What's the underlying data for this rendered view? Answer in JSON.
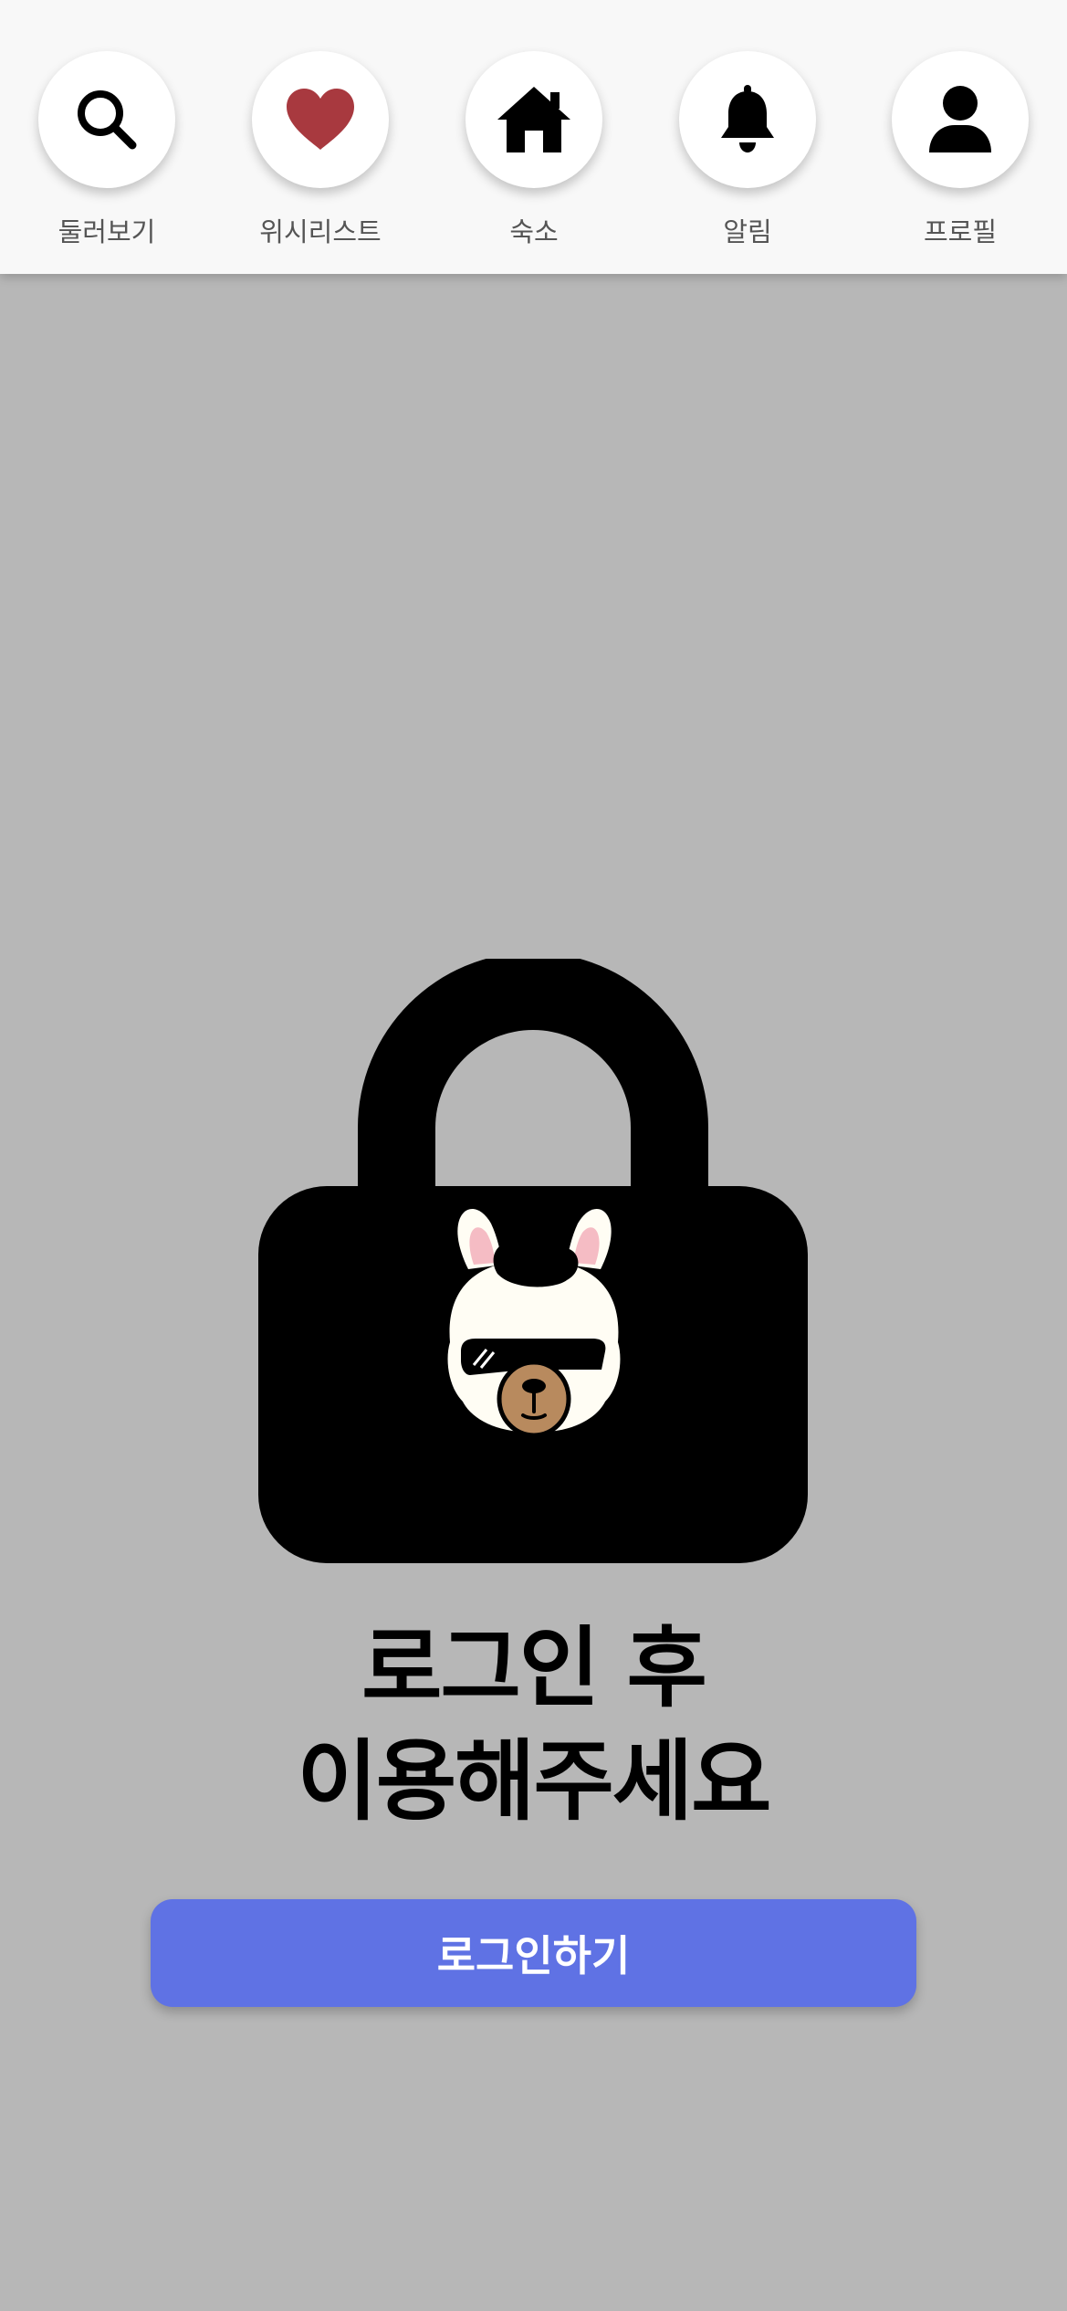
{
  "nav": {
    "items": [
      {
        "label": "둘러보기",
        "icon": "search-icon"
      },
      {
        "label": "위시리스트",
        "icon": "heart-icon"
      },
      {
        "label": "숙소",
        "icon": "home-icon"
      },
      {
        "label": "알림",
        "icon": "bell-icon"
      },
      {
        "label": "프로필",
        "icon": "user-icon"
      }
    ]
  },
  "main": {
    "illustration": "padlock-icon",
    "mascot": "llama-mascot",
    "title_line1": "로그인 후",
    "title_line2": "이용해주세요",
    "login_button": "로그인하기"
  },
  "colors": {
    "nav_background": "#f8f8f8",
    "page_background": "#b7b7b7",
    "heart": "#a8393f",
    "button": "#5f72e4",
    "button_text": "#ffffff"
  }
}
